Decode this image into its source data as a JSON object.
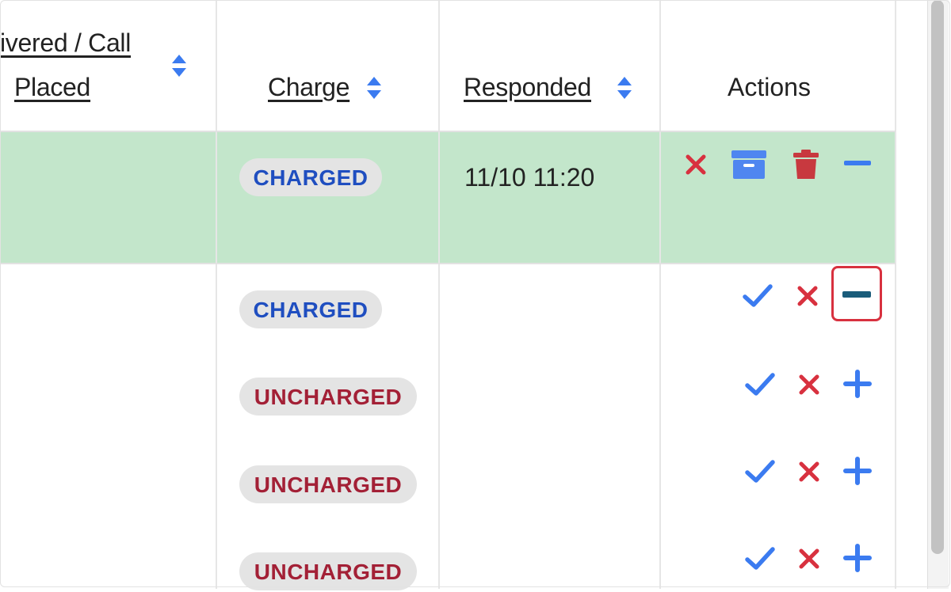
{
  "headers": {
    "delivered_line1": "ivered / Call",
    "delivered_line2": "Placed",
    "charge": "Charge",
    "responded": "Responded",
    "actions": "Actions"
  },
  "rows": [
    {
      "charge": "CHARGED",
      "responded": "11/10 11:20",
      "highlighted": true
    },
    {
      "charge": "CHARGED",
      "responded": ""
    },
    {
      "charge": "UNCHARGED",
      "responded": ""
    },
    {
      "charge": "UNCHARGED",
      "responded": ""
    },
    {
      "charge": "UNCHARGED",
      "responded": ""
    }
  ],
  "colors": {
    "highlight_row": "#c3e6cb",
    "charged_text": "#1f4ec0",
    "uncharged_text": "#a32036",
    "badge_bg": "#e4e4e4",
    "icon_blue": "#3b7bf0",
    "icon_red": "#d8313f",
    "archive_blue": "#4f86f0",
    "trash_red": "#c8393f",
    "minus_dark": "#1a5c7a"
  },
  "icons": {
    "row1_actions": [
      "close-icon",
      "archive-icon",
      "trash-icon",
      "minus-icon"
    ],
    "row2_actions": [
      "check-icon",
      "close-icon",
      "minus-icon"
    ],
    "row3_actions": [
      "check-icon",
      "close-icon",
      "plus-icon"
    ],
    "row4_actions": [
      "check-icon",
      "close-icon",
      "plus-icon"
    ],
    "row5_actions": [
      "check-icon",
      "close-icon",
      "plus-icon"
    ]
  }
}
